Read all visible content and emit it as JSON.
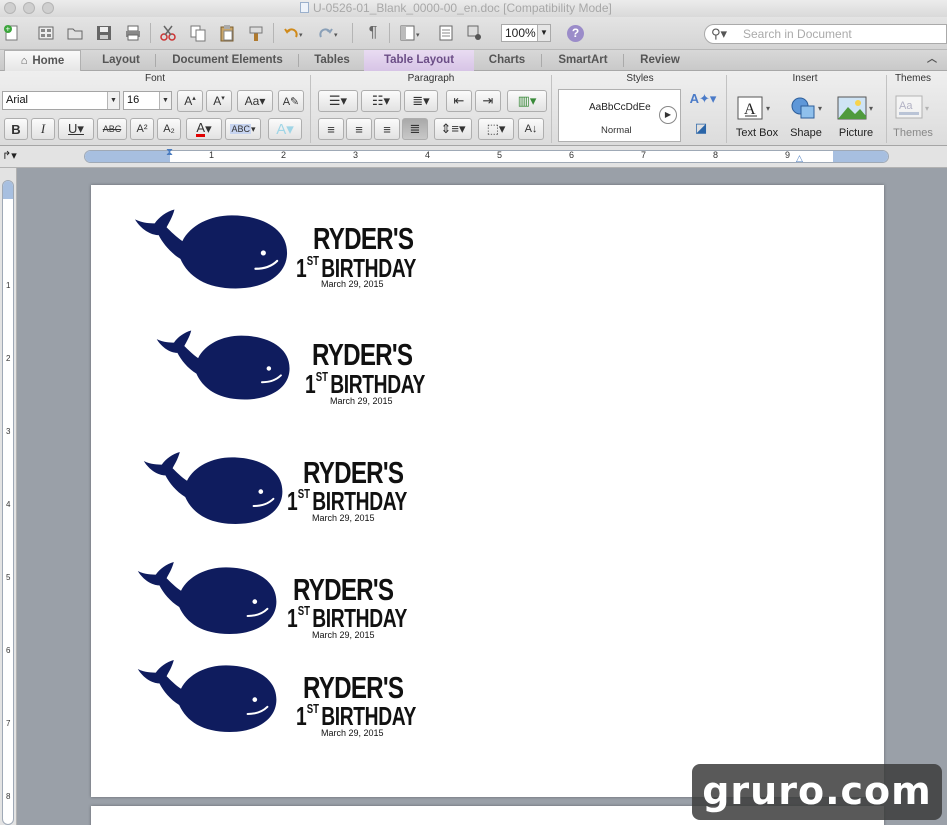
{
  "window": {
    "title": "U-0526-01_Blank_0000-00_en.doc [Compatibility Mode]"
  },
  "toolbar": {
    "zoom_value": "100%",
    "search_placeholder": "Search in Document"
  },
  "tabs": [
    {
      "label": "Home"
    },
    {
      "label": "Layout"
    },
    {
      "label": "Document Elements"
    },
    {
      "label": "Tables"
    },
    {
      "label": "Table Layout"
    },
    {
      "label": "Charts"
    },
    {
      "label": "SmartArt"
    },
    {
      "label": "Review"
    }
  ],
  "ribbon": {
    "font_group_label": "Font",
    "paragraph_group_label": "Paragraph",
    "styles_group_label": "Styles",
    "insert_group_label": "Insert",
    "themes_group_label": "Themes",
    "font_name": "Arial",
    "font_size": "16",
    "style_sample": "AaBbCcDdEe",
    "style_name": "Normal",
    "text_box_label": "Text Box",
    "shape_label": "Shape",
    "picture_label": "Picture",
    "themes_label": "Themes",
    "font_color": "#e00000"
  },
  "ruler": {
    "numbers": [
      "1",
      "2",
      "3",
      "4",
      "5",
      "6",
      "7",
      "8",
      "9"
    ],
    "vertical_numbers": [
      "1",
      "2",
      "3",
      "4",
      "5",
      "6",
      "7",
      "8"
    ]
  },
  "labels": [
    {
      "name": "RYDER'S",
      "ordinal_number": "1",
      "ordinal_suffix": "ST",
      "event": "BIRTHDAY",
      "date": "March 29, 2015"
    },
    {
      "name": "RYDER'S",
      "ordinal_number": "1",
      "ordinal_suffix": "ST",
      "event": "BIRTHDAY",
      "date": "March 29, 2015"
    },
    {
      "name": "RYDER'S",
      "ordinal_number": "1",
      "ordinal_suffix": "ST",
      "event": "BIRTHDAY",
      "date": "March 29, 2015"
    },
    {
      "name": "RYDER'S",
      "ordinal_number": "1",
      "ordinal_suffix": "ST",
      "event": "BIRTHDAY",
      "date": "March 29, 2015"
    },
    {
      "name": "RYDER'S",
      "ordinal_number": "1",
      "ordinal_suffix": "ST",
      "event": "BIRTHDAY",
      "date": "March 29, 2015"
    }
  ],
  "colors": {
    "whale": "#0f1c5e",
    "active_tab": "#d7c4e6"
  },
  "watermark": {
    "text": "gruro.com"
  }
}
